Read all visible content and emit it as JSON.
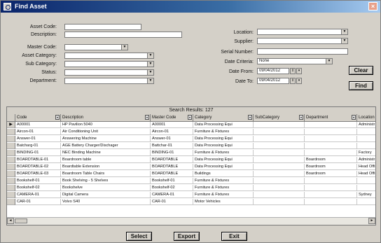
{
  "window": {
    "title": "Find Asset",
    "close_glyph": "×"
  },
  "form_left": {
    "fields": [
      {
        "label": "Asset Code:",
        "value": "",
        "kind": "text"
      },
      {
        "label": "Description:",
        "value": "",
        "kind": "text"
      },
      {
        "label": "Master Code:",
        "value": "",
        "kind": "combo"
      },
      {
        "label": "Asset Category:",
        "value": "",
        "kind": "combo"
      },
      {
        "label": "Sub Category:",
        "value": "",
        "kind": "combo"
      },
      {
        "label": "Status:",
        "value": "",
        "kind": "combo"
      },
      {
        "label": "Department:",
        "value": "",
        "kind": "combo"
      }
    ]
  },
  "form_right": {
    "location": {
      "label": "Location:",
      "value": ""
    },
    "supplier": {
      "label": "Supplier:",
      "value": ""
    },
    "serial": {
      "label": "Serial Number:",
      "value": ""
    },
    "date_criteria": {
      "label": "Date Criteria:",
      "value": "None"
    },
    "date_from": {
      "label": "Date From:",
      "value": "09/04/2012"
    },
    "date_to": {
      "label": "Date To:",
      "value": "09/04/2012"
    }
  },
  "buttons": {
    "clear": "Clear",
    "find": "Find",
    "select": "Select",
    "export": "Export",
    "exit": "Exit"
  },
  "results": {
    "caption": "Search Results: 127",
    "columns": [
      "Code",
      "Description",
      "Master Code",
      "Category",
      "SubCategory",
      "Department",
      "Location"
    ],
    "rows": [
      [
        "A00001",
        "HP Pavilion 5040",
        "A00001",
        "Data Processing Equi",
        "",
        "",
        "Administr"
      ],
      [
        "Aircon-01",
        "Air Conditioning Unit",
        "Aircon-01",
        "Furniture & Fixtures",
        "",
        "",
        ""
      ],
      [
        "Answer-01",
        "Answering Machine",
        "Answer-01",
        "Data Processing Equi",
        "",
        "",
        ""
      ],
      [
        "Batcharg-01",
        "AGE Battery Charger/Dischager",
        "Battchar-01",
        "Data Processing Equi",
        "",
        "",
        ""
      ],
      [
        "BINDING-01",
        "NEC Binding Machine",
        "BINDING-01",
        "Furniture & Fixtures",
        "",
        "",
        "Factory"
      ],
      [
        "BOARDTABLE-01",
        "Boardroom table",
        "BOARDTABLE",
        "Data Processing Equi",
        "",
        "Boardroom",
        "Administr"
      ],
      [
        "BOARDTABLE-02",
        "Boardtable Extension",
        "BOARDTABLE",
        "Data Processing Equi",
        "",
        "Boardroom",
        "Head Offi"
      ],
      [
        "BOARDTABLE-03",
        "Boardroom Table Chairs",
        "BOARDTABLE",
        "Buildings",
        "",
        "Boardroom",
        "Head Offi"
      ],
      [
        "Bookshelf-01",
        "Book Shelving - 5 Shelves",
        "Bookshelf-01",
        "Furniture & Fixtures",
        "",
        "",
        ""
      ],
      [
        "Bookshelf-02",
        "Bookshelve",
        "Bookshelf-02",
        "Furniture & Fixtures",
        "",
        "",
        ""
      ],
      [
        "CAMERA-01",
        "Digital Camera",
        "CAMERA-01",
        "Furniture & Fixtures",
        "",
        "",
        "Sydney"
      ],
      [
        "CAR-01",
        "Volvo S40",
        "CAR-01",
        "Motor Vehicles",
        "",
        "",
        ""
      ]
    ]
  }
}
